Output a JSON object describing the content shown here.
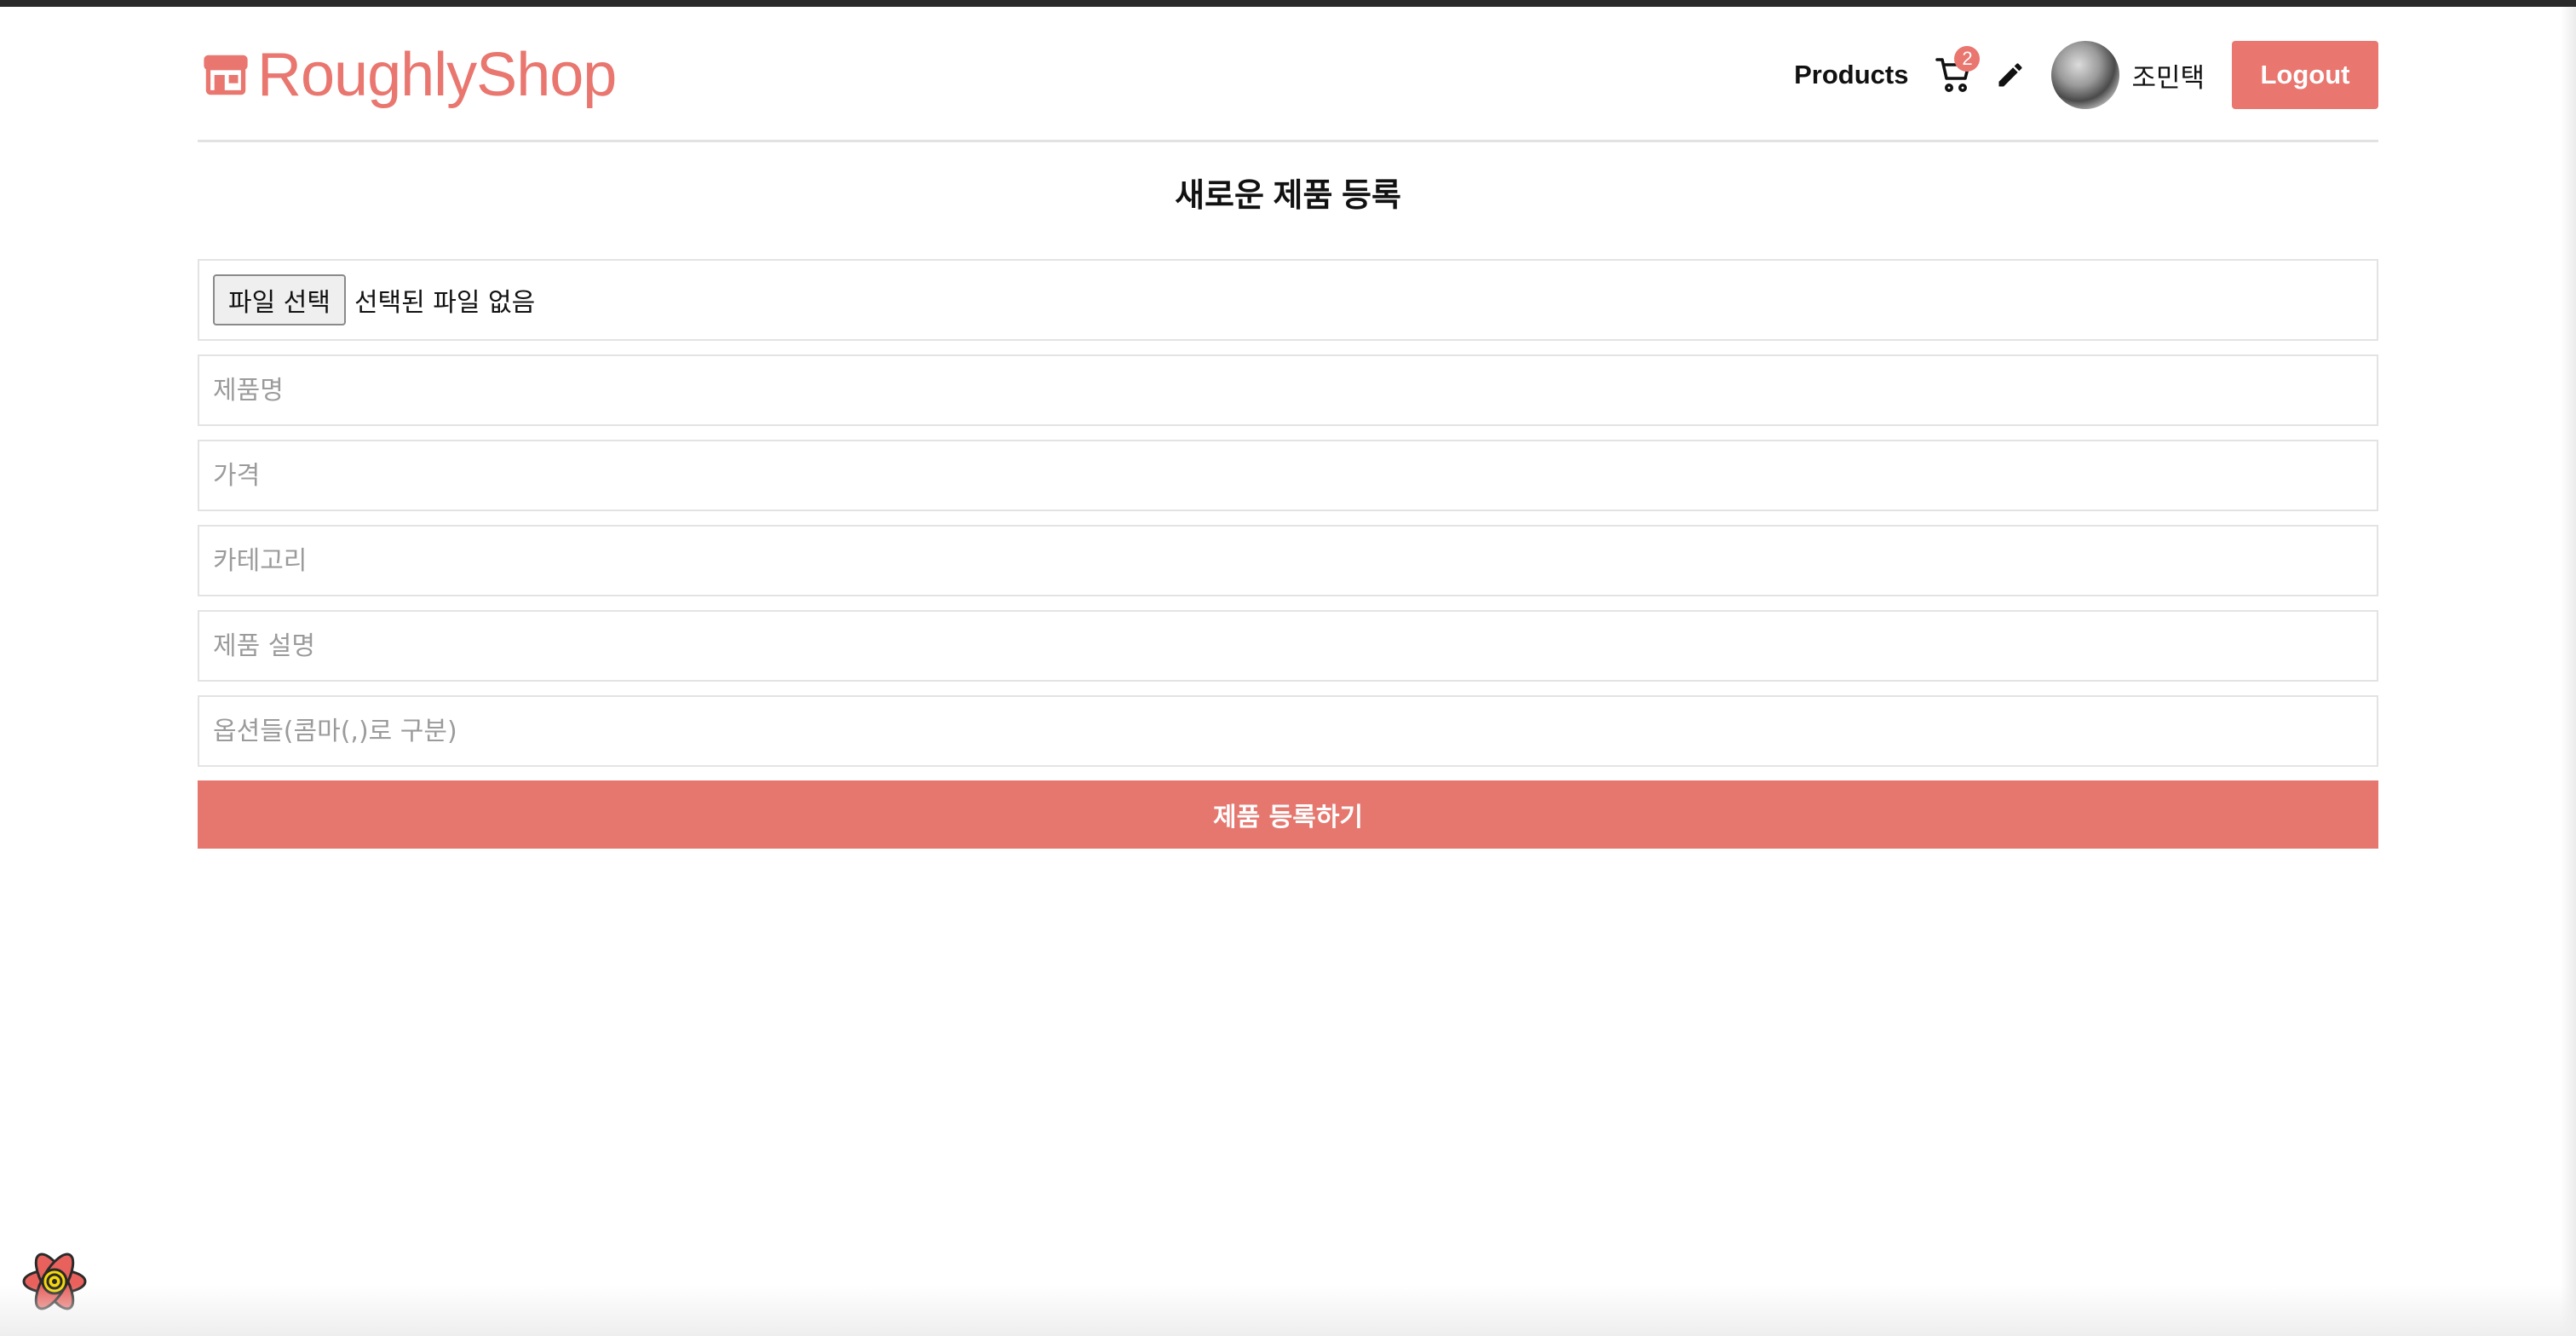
{
  "header": {
    "logo_text": "RoughlyShop",
    "logo_icon": "store-icon",
    "nav_products": "Products",
    "cart_count": "2",
    "cart_icon": "cart-icon",
    "edit_icon": "pencil-icon",
    "username": "조민택",
    "logout_label": "Logout"
  },
  "page": {
    "title": "새로운 제품 등록"
  },
  "form": {
    "file_button_label": "파일 선택",
    "file_status": "선택된 파일 없음",
    "fields": {
      "name_placeholder": "제품명",
      "price_placeholder": "가격",
      "category_placeholder": "카테고리",
      "description_placeholder": "제품 설명",
      "options_placeholder": "옵션들(콤마(,)로 구분)"
    },
    "submit_label": "제품 등록하기"
  },
  "colors": {
    "accent": "#e9766f",
    "submit": "#e5776f"
  }
}
